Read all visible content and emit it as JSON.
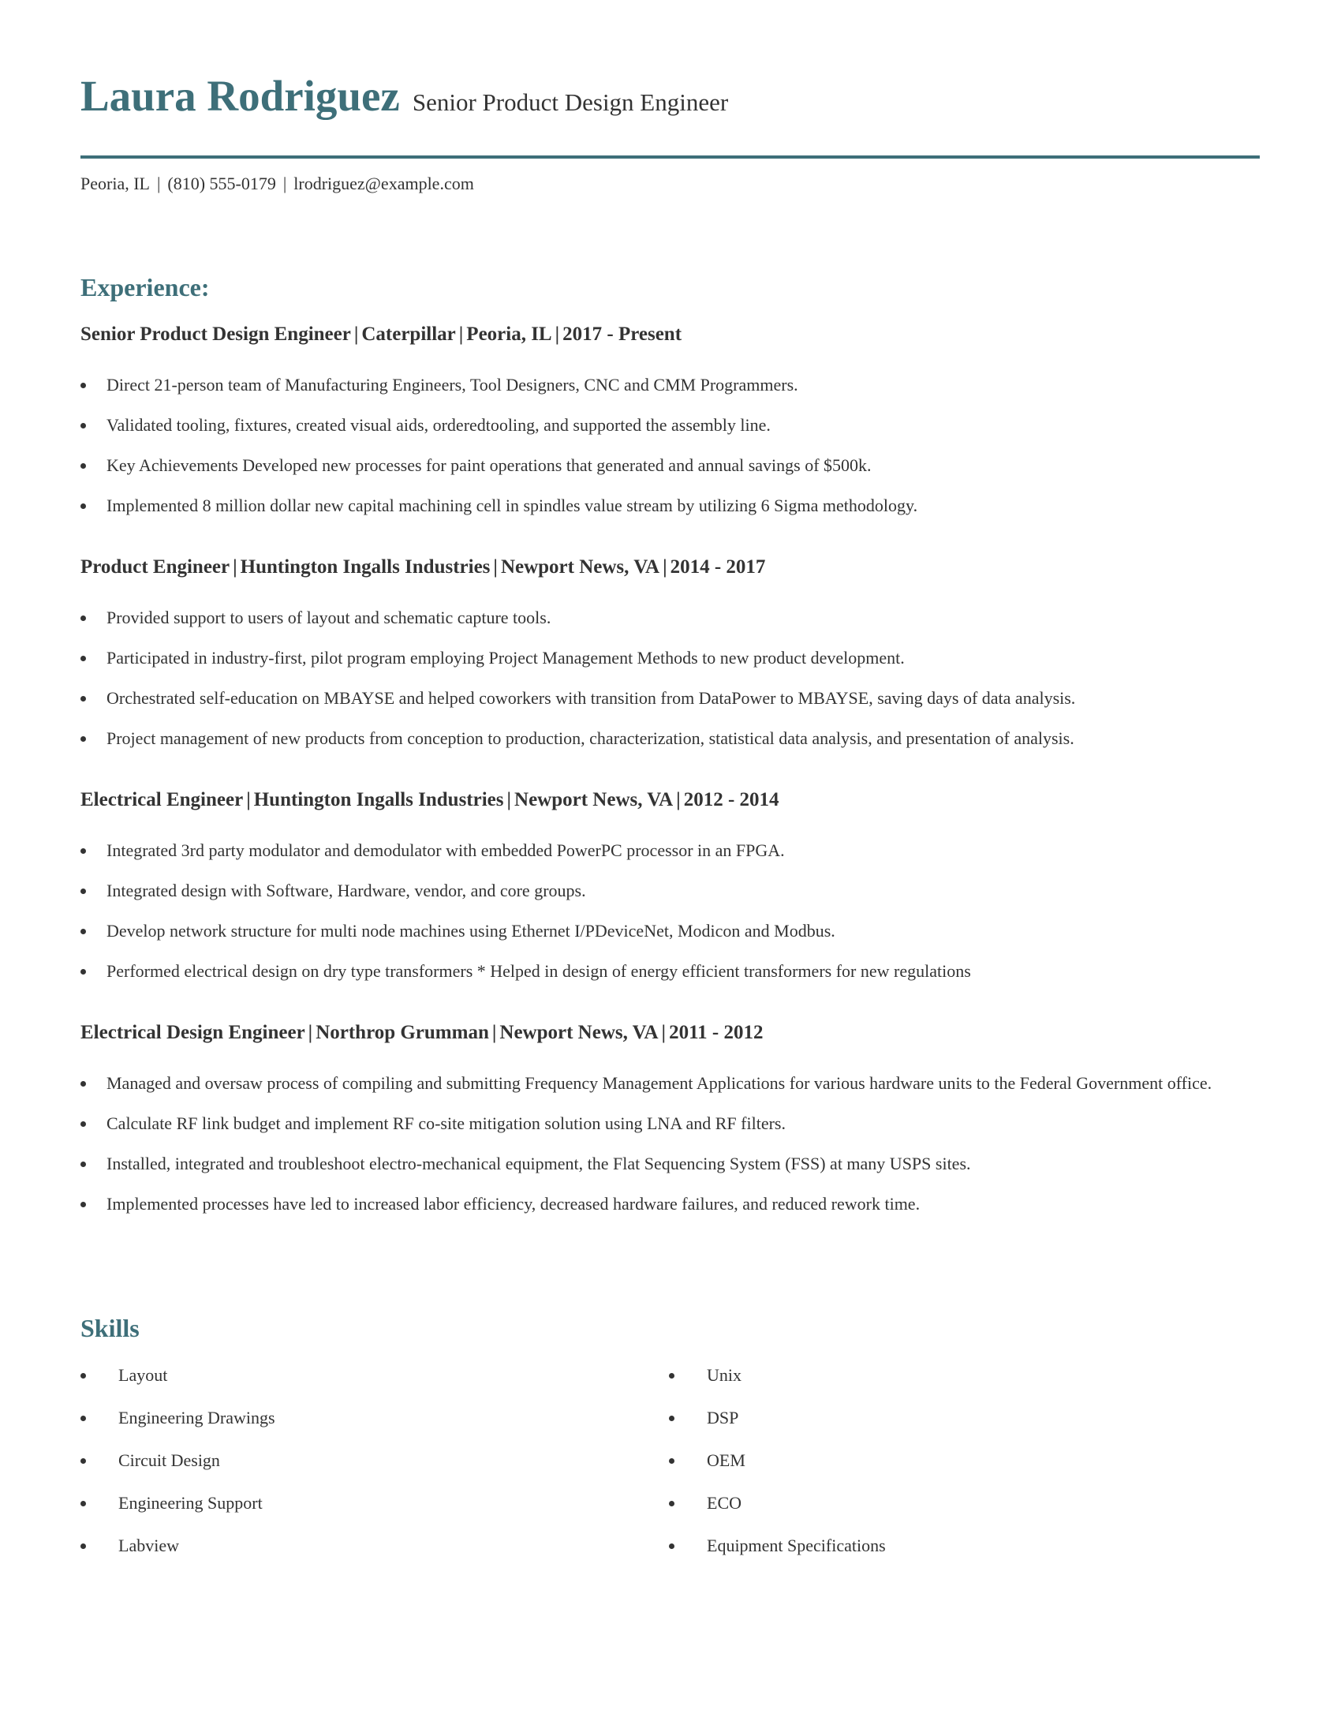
{
  "header": {
    "name": "Laura Rodriguez",
    "title": "Senior Product Design Engineer",
    "contact": {
      "location": "Peoria, IL",
      "phone": "(810) 555-0179",
      "email": "lrodriguez@example.com",
      "separator": "|"
    }
  },
  "colors": {
    "accent": "#3e6f79",
    "text": "#333333"
  },
  "experience": {
    "heading": "Experience:",
    "jobs": [
      {
        "role": "Senior Product Design Engineer",
        "company": "Caterpillar",
        "location": "Peoria, IL",
        "dates": "2017 - Present",
        "bullets": [
          "Direct 21-person team of Manufacturing Engineers, Tool Designers, CNC and CMM Programmers.",
          "Validated tooling, fixtures, created visual aids, orderedtooling, and supported the assembly line.",
          "Key Achievements Developed new processes for paint operations that generated and annual savings of $500k.",
          "Implemented 8 million dollar new capital machining cell in spindles value stream by utilizing 6 Sigma methodology."
        ]
      },
      {
        "role": "Product Engineer",
        "company": "Huntington Ingalls Industries",
        "location": "Newport News, VA",
        "dates": "2014 - 2017",
        "bullets": [
          "Provided support to users of layout and schematic capture tools.",
          "Participated in industry-first, pilot program employing Project Management Methods to new product development.",
          "Orchestrated self-education on MBAYSE and helped coworkers with transition from DataPower to MBAYSE, saving days of data analysis.",
          "Project management of new products from conception to production, characterization, statistical data analysis, and presentation of analysis."
        ]
      },
      {
        "role": "Electrical Engineer",
        "company": "Huntington Ingalls Industries",
        "location": "Newport News, VA",
        "dates": "2012 - 2014",
        "bullets": [
          "Integrated 3rd party modulator and demodulator with embedded PowerPC processor in an FPGA.",
          "Integrated design with Software, Hardware, vendor, and core groups.",
          "Develop network structure for multi node machines using Ethernet I/PDeviceNet, Modicon and Modbus.",
          "Performed electrical design on dry type transformers * Helped in design of energy efficient transformers for new regulations"
        ]
      },
      {
        "role": "Electrical Design Engineer",
        "company": "Northrop Grumman",
        "location": "Newport News, VA",
        "dates": "2011 - 2012",
        "bullets": [
          "Managed and oversaw process of compiling and submitting Frequency Management Applications for various hardware units to the Federal Government office.",
          "Calculate RF link budget and implement RF co-site mitigation solution using LNA and RF filters.",
          "Installed, integrated and troubleshoot electro-mechanical equipment, the Flat Sequencing System (FSS) at many USPS sites.",
          "Implemented processes have led to increased labor efficiency, decreased hardware failures, and reduced rework time."
        ]
      }
    ]
  },
  "skills": {
    "heading": "Skills",
    "left": [
      "Layout",
      "Engineering Drawings",
      "Circuit Design",
      "Engineering Support",
      "Labview"
    ],
    "right": [
      "Unix",
      "DSP",
      "OEM",
      "ECO",
      "Equipment Specifications"
    ]
  }
}
